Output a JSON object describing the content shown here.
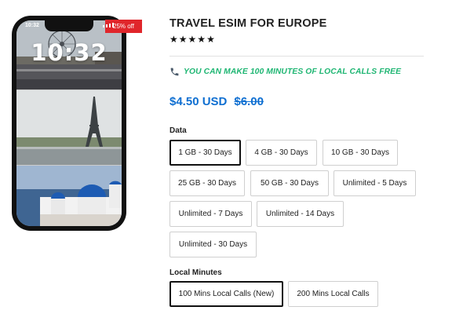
{
  "phone": {
    "status_time": "10:32",
    "lock_time": "10:32"
  },
  "badge": "25% off",
  "product": {
    "title": "TRAVEL ESIM FOR EUROPE",
    "rating": 5,
    "rating_max": 5,
    "promo_icon": "phone-icon",
    "promo": "YOU CAN MAKE 100 MINUTES OF LOCAL CALLS FREE",
    "price": "$4.50 USD",
    "price_original": "$6.00"
  },
  "colors": {
    "badge": "#e0262b",
    "price": "#0f6fd1",
    "promo": "#1fb673",
    "selected_border": "#111111"
  },
  "data_options": {
    "label": "Data",
    "selected": "1 GB - 30 Days",
    "options": [
      "1 GB - 30 Days",
      "4 GB - 30 Days",
      "10 GB - 30 Days",
      "25 GB - 30 Days",
      "50 GB - 30 Days",
      "Unlimited - 5 Days",
      "Unlimited - 7 Days",
      "Unlimited - 14 Days",
      "Unlimited - 30 Days"
    ]
  },
  "minutes_options": {
    "label": "Local Minutes",
    "selected": "100 Mins Local Calls (New)",
    "options": [
      "100 Mins Local Calls (New)",
      "200 Mins Local Calls"
    ]
  }
}
